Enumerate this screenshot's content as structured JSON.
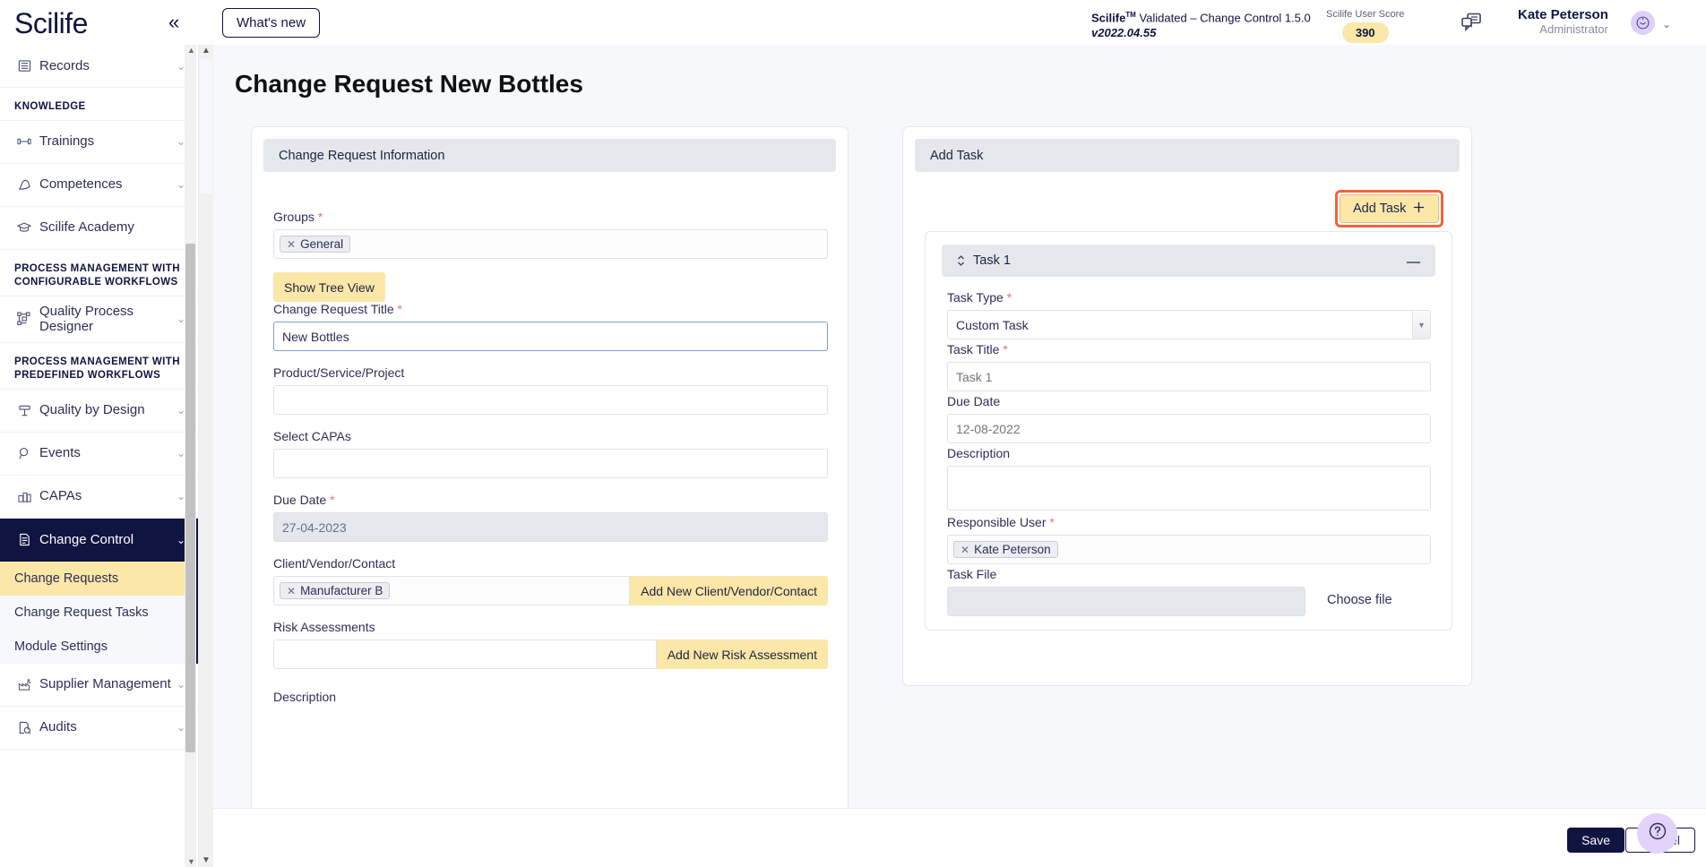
{
  "topbar": {
    "brand": "Scilife",
    "collapse_icon": "chevron-double-left-icon",
    "whats_new": "What's new",
    "product_name": "Scilife",
    "product_tm": "TM",
    "product_suffix": " Validated – Change Control 1.5.0",
    "product_version": "v2022.04.55",
    "score_label": "Scilife User Score",
    "score_value": "390",
    "chat_icon": "chat-bubble-icon",
    "user_name": "Kate Peterson",
    "user_role": "Administrator",
    "avatar_icon": "smiley-avatar-icon",
    "avatar_caret": "chevron-down-icon"
  },
  "sidebar": {
    "items": [
      {
        "label": "Records",
        "icon": "records-icon",
        "caret": true
      }
    ],
    "sections": [
      {
        "title": "KNOWLEDGE",
        "items": [
          {
            "label": "Trainings",
            "icon": "dumbbell-icon",
            "caret": true
          },
          {
            "label": "Competences",
            "icon": "muscle-icon",
            "caret": true
          },
          {
            "label": "Scilife Academy",
            "icon": "graduation-cap-icon",
            "caret": false
          }
        ]
      },
      {
        "title": "PROCESS MANAGEMENT WITH CONFIGURABLE WORKFLOWS",
        "items": [
          {
            "label": "Quality Process Designer",
            "icon": "flow-diagram-icon",
            "caret": true
          }
        ]
      },
      {
        "title": "PROCESS MANAGEMENT WITH PREDEFINED WORKFLOWS",
        "items": [
          {
            "label": "Quality by Design",
            "icon": "signpost-icon",
            "caret": true
          },
          {
            "label": "Events",
            "icon": "magnifier-icon",
            "caret": true
          },
          {
            "label": "CAPAs",
            "icon": "capa-icon",
            "caret": true
          },
          {
            "label": "Change Control",
            "icon": "document-gear-icon",
            "caret": true,
            "active": true
          },
          {
            "label": "Supplier Management",
            "icon": "factory-icon",
            "caret": true
          },
          {
            "label": "Audits",
            "icon": "clipboard-search-icon",
            "caret": true
          }
        ]
      }
    ],
    "sub_items": [
      {
        "label": "Change Requests",
        "selected": true
      },
      {
        "label": "Change Request Tasks",
        "selected": false
      },
      {
        "label": "Module Settings",
        "selected": false
      }
    ]
  },
  "page": {
    "title": "Change Request New Bottles"
  },
  "left_card": {
    "header": "Change Request Information",
    "fields": {
      "groups_label": "Groups",
      "groups_tag": "General",
      "show_tree_view": "Show Tree View",
      "title_label": "Change Request Title",
      "title_value": "New Bottles",
      "product_label": "Product/Service/Project",
      "product_value": "",
      "capas_label": "Select CAPAs",
      "capas_value": "",
      "due_date_label": "Due Date",
      "due_date_value": "27-04-2023",
      "client_label": "Client/Vendor/Contact",
      "client_tag": "Manufacturer B",
      "client_add_button": "Add New Client/Vendor/Contact",
      "risk_label": "Risk Assessments",
      "risk_value": "",
      "risk_add_button": "Add New Risk Assessment",
      "description_label": "Description"
    }
  },
  "right_card": {
    "header": "Add Task",
    "add_task_button": "Add Task",
    "add_task_icon": "plus-icon",
    "task": {
      "drag_icon": "sort-updown-icon",
      "title": "Task 1",
      "collapse_icon": "minus-icon",
      "task_type_label": "Task Type",
      "task_type_value": "Custom Task",
      "task_title_label": "Task Title",
      "task_title_placeholder": "Task 1",
      "due_date_label": "Due Date",
      "due_date_placeholder": "12-08-2022",
      "description_label": "Description",
      "description_value": "",
      "responsible_label": "Responsible User",
      "responsible_tag": "Kate Peterson",
      "task_file_label": "Task File",
      "task_file_value": "",
      "choose_file": "Choose file"
    }
  },
  "footer": {
    "save": "Save",
    "cancel": "Cancel",
    "help_icon": "question-mark-icon"
  },
  "colors": {
    "brand_navy": "#101440",
    "accent_yellow": "#fbe7a8",
    "highlight_orange": "#f4633a",
    "required_red": "#e8716e",
    "avatar_purple": "#ddd0fa"
  }
}
